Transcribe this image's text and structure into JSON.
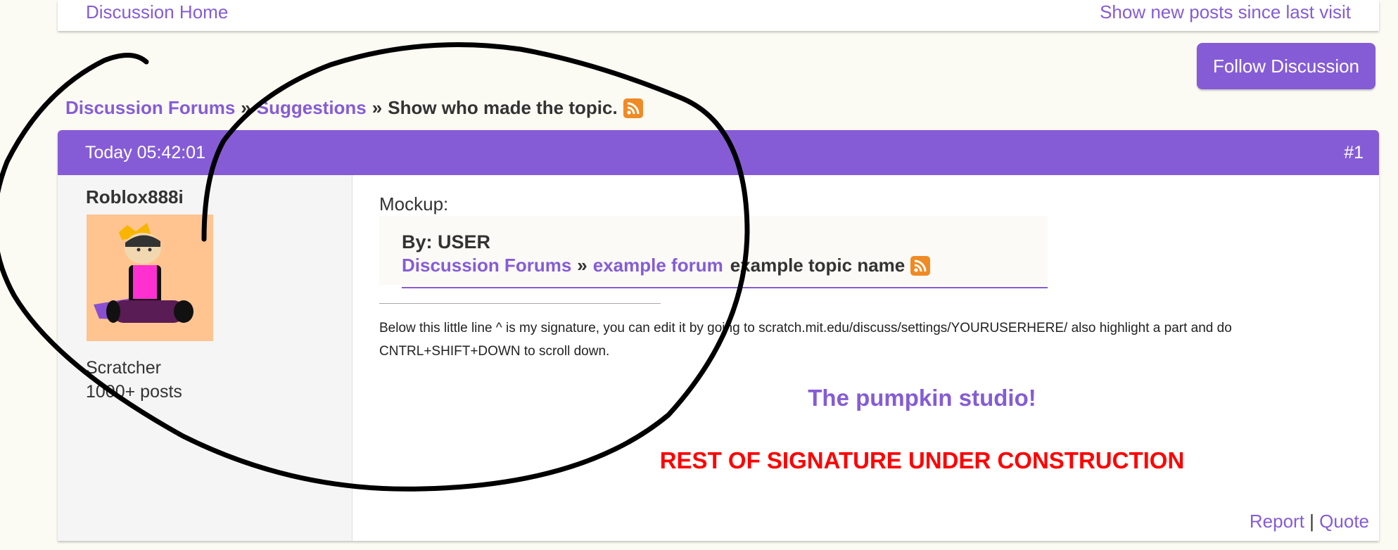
{
  "nav": {
    "discussion_home": "Discussion Home",
    "show_new_posts": "Show new posts since last visit"
  },
  "follow_button": "Follow Discussion",
  "breadcrumb": {
    "forums": "Discussion Forums",
    "sep1": "»",
    "category": "Suggestions",
    "sep2": "»",
    "topic": "Show who made the topic."
  },
  "post": {
    "timestamp": "Today 05:42:01",
    "number": "#1",
    "author": {
      "username": "Roblox888i",
      "rank": "Scratcher",
      "posts": "1000+ posts"
    },
    "content": {
      "mockup_label": "Mockup:",
      "mockup_by": "By: USER",
      "mockup_forums": "Discussion Forums",
      "mockup_sep1": "»",
      "mockup_forum": "example forum",
      "mockup_topic": "example topic name"
    },
    "signature": {
      "text": "Below this little line ^ is my signature, you can edit it by going to scratch.mit.edu/discuss/settings/YOURUSERHERE/ also highlight a part and do CNTRL+SHIFT+DOWN to scroll down.",
      "studio": "The pumpkin studio!",
      "construction": "REST OF SIGNATURE UNDER CONSTRUCTION"
    },
    "actions": {
      "report": "Report",
      "divider": "|",
      "quote": "Quote"
    }
  },
  "colors": {
    "accent": "#855cd6",
    "rss": "#f08a24",
    "construction": "#ff0000",
    "annotation": "#000000"
  }
}
